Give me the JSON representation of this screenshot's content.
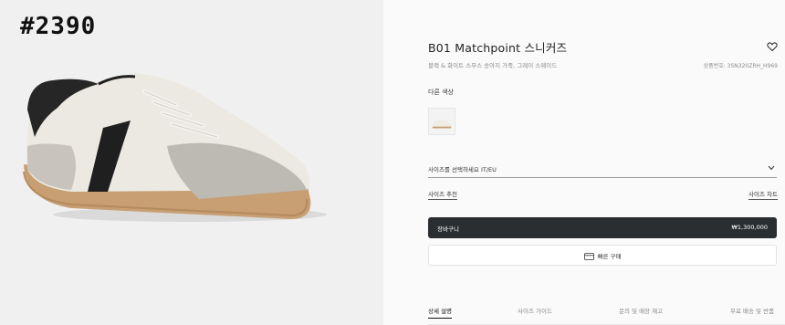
{
  "overlay": {
    "code": "#2390"
  },
  "product": {
    "title": "B01 Matchpoint 스니커즈",
    "subtitle": "블랙 & 화이트 스무스 송아지 가죽, 그레이 스웨이드",
    "sku": "상품번호: 3SN320ZRH_H969"
  },
  "colors": {
    "label": "다른 색상"
  },
  "size": {
    "select_label": "사이즈를 선택하세요 IT/EU",
    "recommend_label": "사이즈 추천",
    "guide_label": "사이즈 차트"
  },
  "cart": {
    "label": "장바구니",
    "price": "₩1,300,000"
  },
  "quick_buy": {
    "label": "빠른 구매"
  },
  "tabs": [
    {
      "label": "상세 설명",
      "active": true
    },
    {
      "label": "사이즈 가이드",
      "active": false
    },
    {
      "label": "문의 및 매장 재고",
      "active": false
    },
    {
      "label": "무료 배송 및 반품",
      "active": false
    }
  ],
  "icons": {
    "wishlist": "heart-icon",
    "size_dropdown": "chevron-down-icon",
    "quick_buy": "card-icon"
  },
  "colors_palette": {
    "cart_button_bg": "#2b2e31",
    "left_panel_bg": "#f0f0f0",
    "right_panel_bg": "#fafafa"
  }
}
